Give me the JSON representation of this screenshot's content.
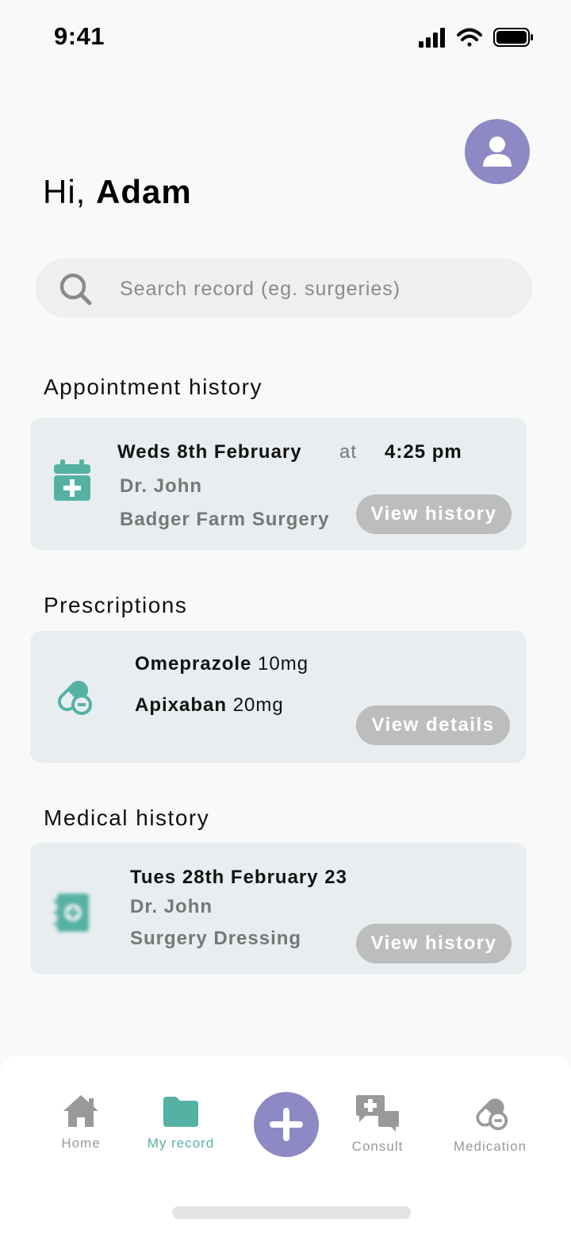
{
  "status_bar": {
    "time": "9:41"
  },
  "greeting": {
    "prefix": "Hi, ",
    "name": "Adam"
  },
  "search": {
    "placeholder": "Search record (eg. surgeries)"
  },
  "appointment_history": {
    "title": "Appointment history",
    "date": "Weds 8th February",
    "at": "at",
    "time": "4:25 pm",
    "doctor": "Dr. John",
    "location": "Badger Farm Surgery",
    "button": "View history"
  },
  "prescriptions": {
    "title": "Prescriptions",
    "items": [
      {
        "name": "Omeprazole",
        "dose": " 10mg"
      },
      {
        "name": "Apixaban",
        "dose": " 20mg"
      }
    ],
    "button": "View details"
  },
  "medical_history": {
    "title": "Medical history",
    "date": "Tues 28th February 23",
    "doctor": "Dr. John",
    "procedure": "Surgery Dressing",
    "button": "View history"
  },
  "nav": {
    "items": [
      {
        "label": "Home",
        "icon": "home-icon"
      },
      {
        "label": "My record",
        "icon": "folder-icon"
      },
      {
        "label": "Consult",
        "icon": "chat-icon"
      },
      {
        "label": "Medication",
        "icon": "pill-icon"
      }
    ],
    "active": "My record"
  },
  "colors": {
    "accent": "#8e88c4",
    "teal": "#56b1a5",
    "card": "#e8edf0",
    "pill_button": "#bdbdbd"
  }
}
